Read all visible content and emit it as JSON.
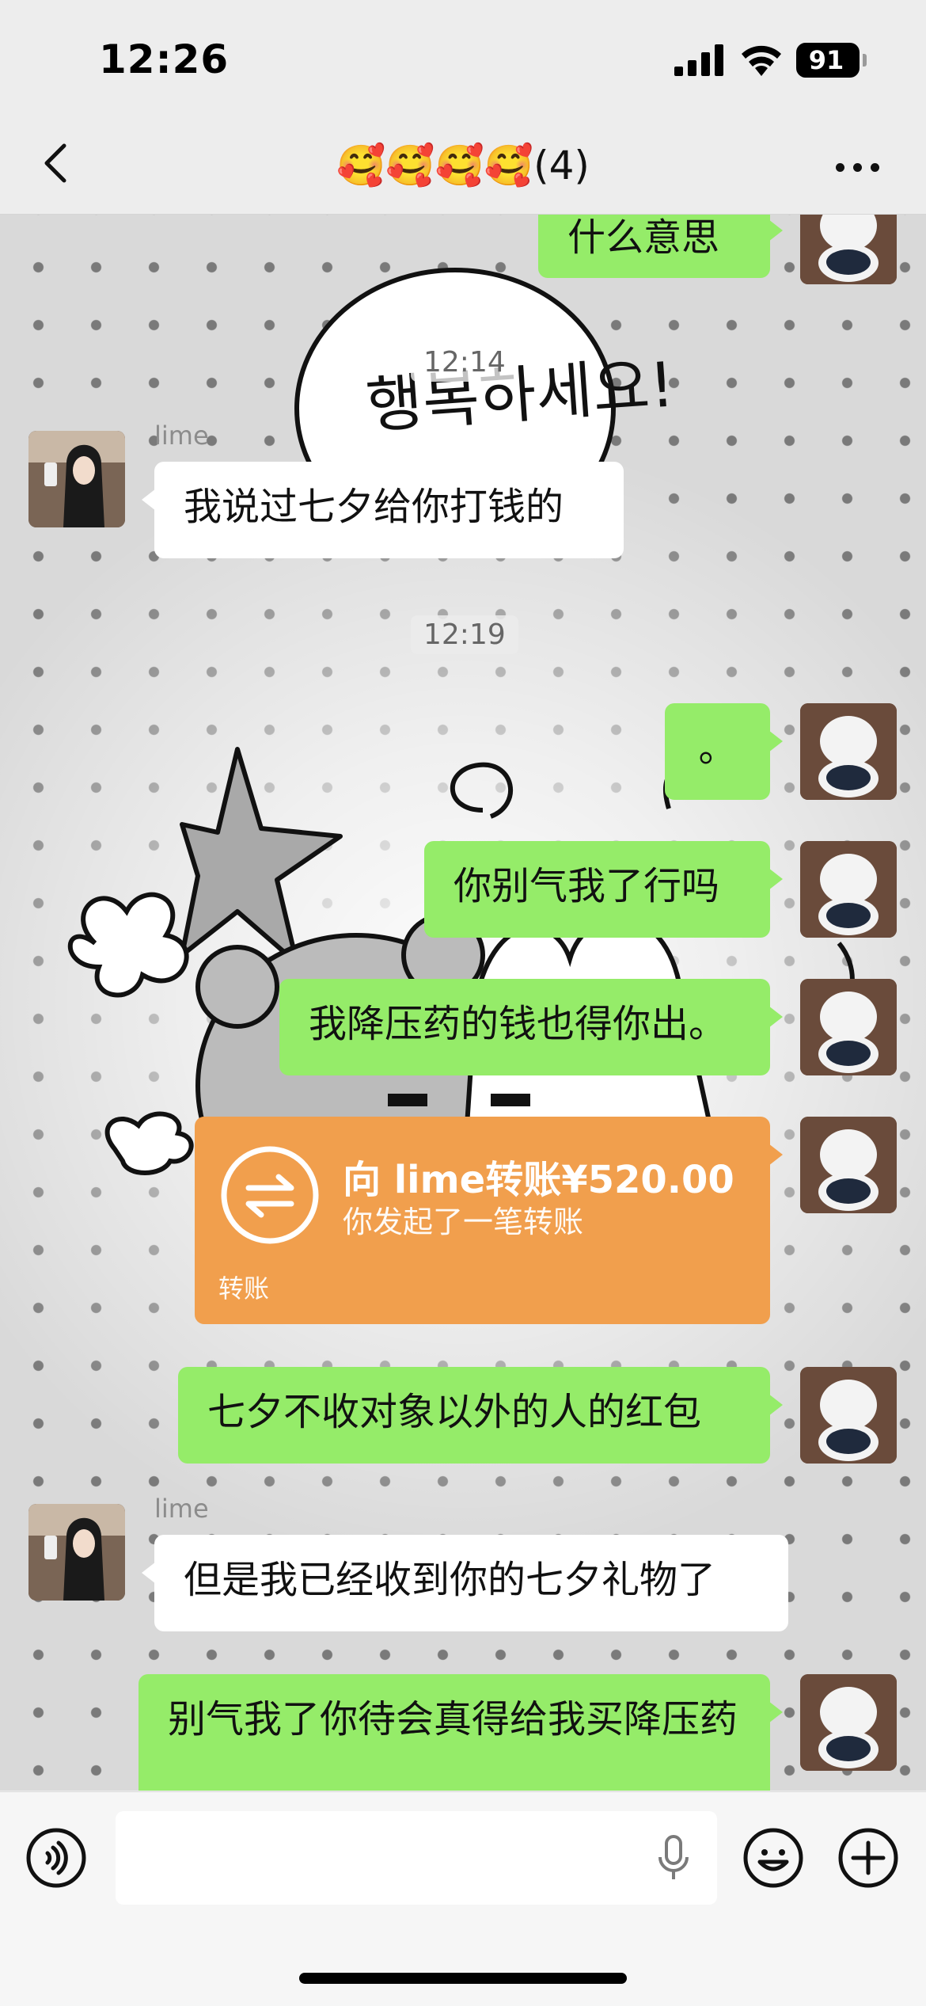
{
  "status_bar": {
    "time": "12:26",
    "battery": "91",
    "icons": [
      "signal-icon",
      "wifi-icon",
      "battery-icon"
    ]
  },
  "nav": {
    "title": "🥰🥰🥰🥰(4)",
    "back_icon": "chevron-left-icon",
    "more_icon": "more-icon"
  },
  "chat": {
    "messages": [
      {
        "type": "text",
        "from": "me",
        "text": "什么意思"
      },
      {
        "type": "timestamp",
        "text": "12:14"
      },
      {
        "type": "text",
        "from": "lime",
        "sender": "lime",
        "text": "我说过七夕给你打钱的"
      },
      {
        "type": "timestamp",
        "text": "12:19"
      },
      {
        "type": "text",
        "from": "me",
        "text": "。"
      },
      {
        "type": "text",
        "from": "me",
        "text": "你别气我了行吗"
      },
      {
        "type": "text",
        "from": "me",
        "text": "我降压药的钱也得你出。"
      },
      {
        "type": "transfer",
        "from": "me",
        "amount_text": "向 lime转账¥520.00",
        "desc": "你发起了一笔转账",
        "label": "转账"
      },
      {
        "type": "text",
        "from": "me",
        "text": "七夕不收对象以外的人的红包"
      },
      {
        "type": "text",
        "from": "lime",
        "sender": "lime",
        "text": "但是我已经收到你的七夕礼物了"
      },
      {
        "type": "text",
        "from": "me",
        "text": "别气我了你待会真得给我买降压药"
      }
    ],
    "background_text": "행복하세요!"
  },
  "input_bar": {
    "voice_icon": "voice-icon",
    "mic_icon": "microphone-icon",
    "emoji_icon": "emoji-icon",
    "plus_icon": "plus-icon",
    "text_value": ""
  },
  "colors": {
    "my_bubble": "#95ec69",
    "their_bubble": "#ffffff",
    "transfer_card": "#f19f4d",
    "background": "#ededed"
  }
}
